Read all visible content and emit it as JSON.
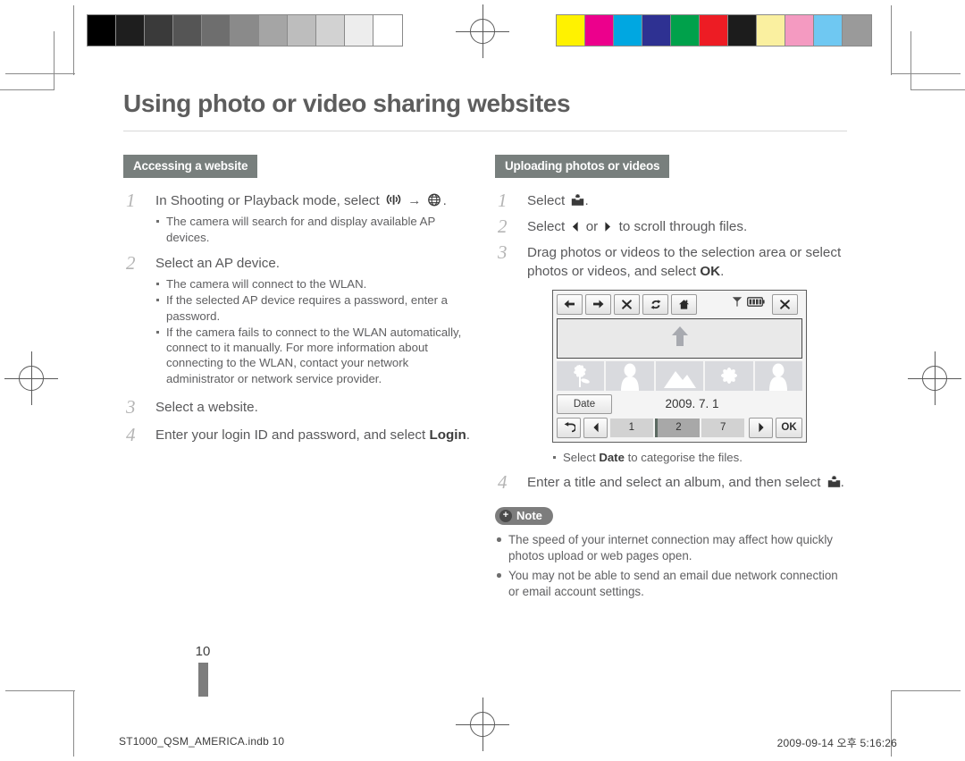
{
  "document": {
    "title": "Using photo or video sharing websites",
    "page_number": "10"
  },
  "print_marks": {
    "grayscale_swatches": [
      "#000000",
      "#1e1e1e",
      "#3a3a3a",
      "#555555",
      "#6e6e6e",
      "#8a8a8a",
      "#a5a5a5",
      "#bdbdbd",
      "#d2d2d2",
      "#ededed",
      "#ffffff"
    ],
    "color_swatches": [
      "#fff200",
      "#ec008c",
      "#00a7e1",
      "#2e3192",
      "#00a14b",
      "#ed1c24",
      "#1c1c1c",
      "#faf0a0",
      "#f49ac1",
      "#6fc8f2",
      "#9a9a9a"
    ]
  },
  "left_column": {
    "section_title": "Accessing a website",
    "steps": [
      {
        "num": "1",
        "text_before": "In Shooting or Playback mode, select",
        "icon_1": "wireless-signal-icon",
        "arrow": "→",
        "icon_2": "globe-icon",
        "text_after": ".",
        "bullets": [
          "The camera will search for and display available AP devices."
        ]
      },
      {
        "num": "2",
        "text": "Select an AP device.",
        "bullets": [
          "The camera will connect to the WLAN.",
          "If the selected AP device requires a password, enter a password.",
          "If the camera fails to connect to the WLAN automatically, connect to it manually. For more information about connecting to the WLAN, contact your network administrator or network service provider."
        ]
      },
      {
        "num": "3",
        "text": "Select a website.",
        "bullets": []
      },
      {
        "num": "4",
        "text_before": "Enter your login ID and password, and select",
        "bold": "Login",
        "text_after": ".",
        "bullets": []
      }
    ]
  },
  "right_column": {
    "section_title": "Uploading photos or videos",
    "steps": [
      {
        "num": "1",
        "text_before": "Select",
        "icon": "upload-icon",
        "text_after": "."
      },
      {
        "num": "2",
        "text_before": "Select",
        "icon_left": "chevron-left-icon",
        "text_mid": "or",
        "icon_right": "chevron-right-icon",
        "text_after": "to scroll through files."
      },
      {
        "num": "3",
        "text_before": "Drag photos or videos to the selection area or select photos or videos, and select",
        "bold": "OK",
        "text_after": "."
      },
      {
        "num": "4",
        "text_before": "Enter a title and select an album, and then select",
        "icon": "upload-icon",
        "text_after": "."
      }
    ],
    "screen_bullet_before": "Select",
    "screen_bullet_bold": "Date",
    "screen_bullet_after": "to categorise the files.",
    "note": {
      "badge_label": "Note",
      "badge_icon": "plus-circle-icon",
      "items": [
        "The speed of your internet connection may affect how quickly photos upload or web pages open.",
        "You may not be able to send an email due network connection or email account settings."
      ]
    }
  },
  "camera_screen": {
    "toolbar": [
      {
        "name": "back-icon",
        "label": "←"
      },
      {
        "name": "forward-icon",
        "label": "→"
      },
      {
        "name": "stop-icon",
        "label": "✕"
      },
      {
        "name": "refresh-icon",
        "label": "⟳"
      },
      {
        "name": "home-icon",
        "label": "⌂"
      }
    ],
    "status": {
      "signal_icon": "antenna-signal-icon",
      "battery_icon": "battery-full-icon",
      "close_label": "✕"
    },
    "selection_area_icon": "up-arrow-icon",
    "thumbnails": [
      "flower",
      "person",
      "mountain",
      "flower",
      "person"
    ],
    "date_button_label": "Date",
    "date_value": "2009. 7. 1",
    "nav": {
      "undo_label": "↰",
      "prev_label": "❮",
      "next_label": "❯",
      "ok_label": "OK"
    },
    "segments": [
      {
        "label": "1",
        "selected": false
      },
      {
        "label": "2",
        "selected": true
      },
      {
        "label": "7",
        "selected": false
      }
    ]
  },
  "footer": {
    "file_name": "ST1000_QSM_AMERICA.indb   10",
    "timestamp": "2009-09-14   오후 5:16:26"
  }
}
